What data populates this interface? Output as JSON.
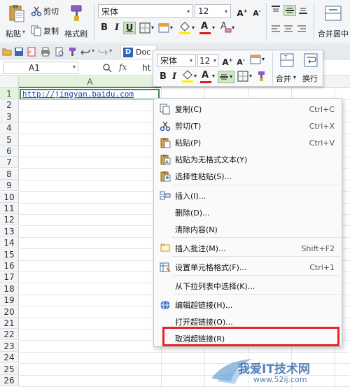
{
  "ribbon": {
    "paste_label": "粘贴",
    "cut_label": "剪切",
    "copy_label": "复制",
    "format_painter_label": "格式刷",
    "font_name": "宋体",
    "font_size": "12",
    "merge_center_label": "合并居中",
    "font_grow": "A+",
    "font_shrink": "A-",
    "bold": "B",
    "italic": "I",
    "underline": "U",
    "font_color_letter": "A",
    "clear_letter": "A"
  },
  "tabbar": {
    "doc_tab": "Doc"
  },
  "formula_bar": {
    "cell_ref": "A1",
    "fx_label": "fx",
    "content": "ht"
  },
  "sheet": {
    "column_a": "A",
    "a1_value": "http://jingyan.baidu.com",
    "rows": [
      "1",
      "2",
      "3",
      "4",
      "5",
      "6",
      "7",
      "8",
      "9",
      "10",
      "11",
      "12",
      "13",
      "14",
      "15",
      "16",
      "17",
      "18",
      "19",
      "20",
      "21",
      "22",
      "23",
      "24",
      "25",
      "26"
    ]
  },
  "mini_toolbar": {
    "font_name": "宋体",
    "font_size": "12",
    "bold": "B",
    "italic": "I",
    "merge_label": "合并",
    "wrap_label": "换行",
    "font_grow": "A+",
    "font_shrink": "A-",
    "font_color_letter": "A"
  },
  "context_menu": {
    "items": [
      {
        "label": "复制(C)",
        "shortcut": "Ctrl+C"
      },
      {
        "label": "剪切(T)",
        "shortcut": "Ctrl+X"
      },
      {
        "label": "粘贴(P)",
        "shortcut": "Ctrl+V"
      },
      {
        "label": "粘贴为无格式文本(Y)",
        "shortcut": ""
      },
      {
        "label": "选择性粘贴(S)...",
        "shortcut": ""
      },
      {
        "label": "插入(I)...",
        "shortcut": ""
      },
      {
        "label": "删除(D)...",
        "shortcut": ""
      },
      {
        "label": "清除内容(N)",
        "shortcut": ""
      },
      {
        "label": "插入批注(M)...",
        "shortcut": "Shift+F2"
      },
      {
        "label": "设置单元格格式(F)...",
        "shortcut": "Ctrl+1"
      },
      {
        "label": "从下拉列表中选择(K)...",
        "shortcut": ""
      },
      {
        "label": "编辑超链接(H)...",
        "shortcut": ""
      },
      {
        "label": "打开超链接(O)...",
        "shortcut": ""
      },
      {
        "label": "取消超链接(R)",
        "shortcut": ""
      }
    ]
  },
  "watermark": {
    "title": "我爱IT技术网",
    "url": "www.52ij.com"
  },
  "colors": {
    "highlight_box": "#e5252a",
    "selection_border": "#3f8a4e",
    "link_text": "#1a3fb8"
  }
}
